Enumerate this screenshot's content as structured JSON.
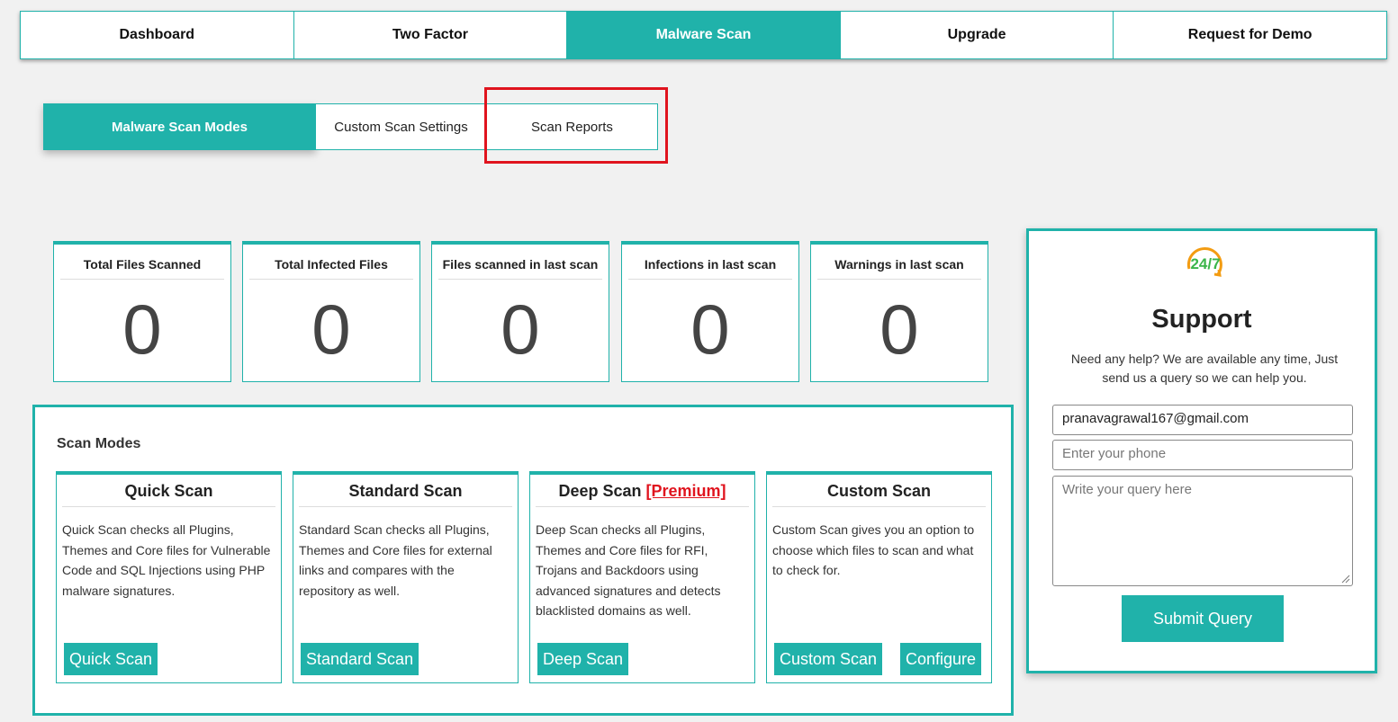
{
  "top_nav": {
    "tabs": [
      {
        "label": "Dashboard"
      },
      {
        "label": "Two Factor"
      },
      {
        "label": "Malware Scan"
      },
      {
        "label": "Upgrade"
      },
      {
        "label": "Request for Demo"
      }
    ],
    "active_tab": "Malware Scan"
  },
  "sub_nav": {
    "tabs": [
      {
        "label": "Malware Scan Modes"
      },
      {
        "label": "Custom Scan Settings"
      },
      {
        "label": "Scan Reports"
      }
    ],
    "active_tab": "Malware Scan Modes",
    "highlighted_tab": "Scan Reports"
  },
  "stats": [
    {
      "title": "Total Files Scanned",
      "value": "0"
    },
    {
      "title": "Total Infected Files",
      "value": "0"
    },
    {
      "title": "Files scanned in last scan",
      "value": "0"
    },
    {
      "title": "Infections in last scan",
      "value": "0"
    },
    {
      "title": "Warnings in last scan",
      "value": "0"
    }
  ],
  "scan_modes": {
    "title": "Scan Modes",
    "modes": [
      {
        "title": "Quick Scan",
        "description": "Quick Scan checks all Plugins, Themes and Core files for Vulnerable Code and SQL Injections using PHP malware signatures.",
        "button": "Quick Scan"
      },
      {
        "title": "Standard Scan",
        "description": "Standard Scan checks all Plugins, Themes and Core files for external links and compares with the repository as well.",
        "button": "Standard Scan"
      },
      {
        "title": "Deep Scan",
        "premium_tag": "[Premium]",
        "description": "Deep Scan checks all Plugins, Themes and Core files for RFI, Trojans and Backdoors using advanced signatures and detects blacklisted domains as well.",
        "button": "Deep Scan"
      },
      {
        "title": "Custom Scan",
        "description": "Custom Scan gives you an option to choose which files to scan and what to check for.",
        "button": "Custom Scan",
        "button2": "Configure"
      }
    ]
  },
  "support": {
    "icon": "24-7-icon",
    "icon_text": "24/7",
    "title": "Support",
    "text": "Need any help? We are available any time, Just send us a query so we can help you.",
    "email_value": "pranavagrawal167@gmail.com",
    "phone_placeholder": "Enter your phone",
    "query_placeholder": "Write your query here",
    "submit_label": "Submit Query"
  },
  "colors": {
    "accent": "#20b2aa",
    "highlight": "#e0141e",
    "premium": "#e0141e",
    "background": "#f1f1f1"
  }
}
